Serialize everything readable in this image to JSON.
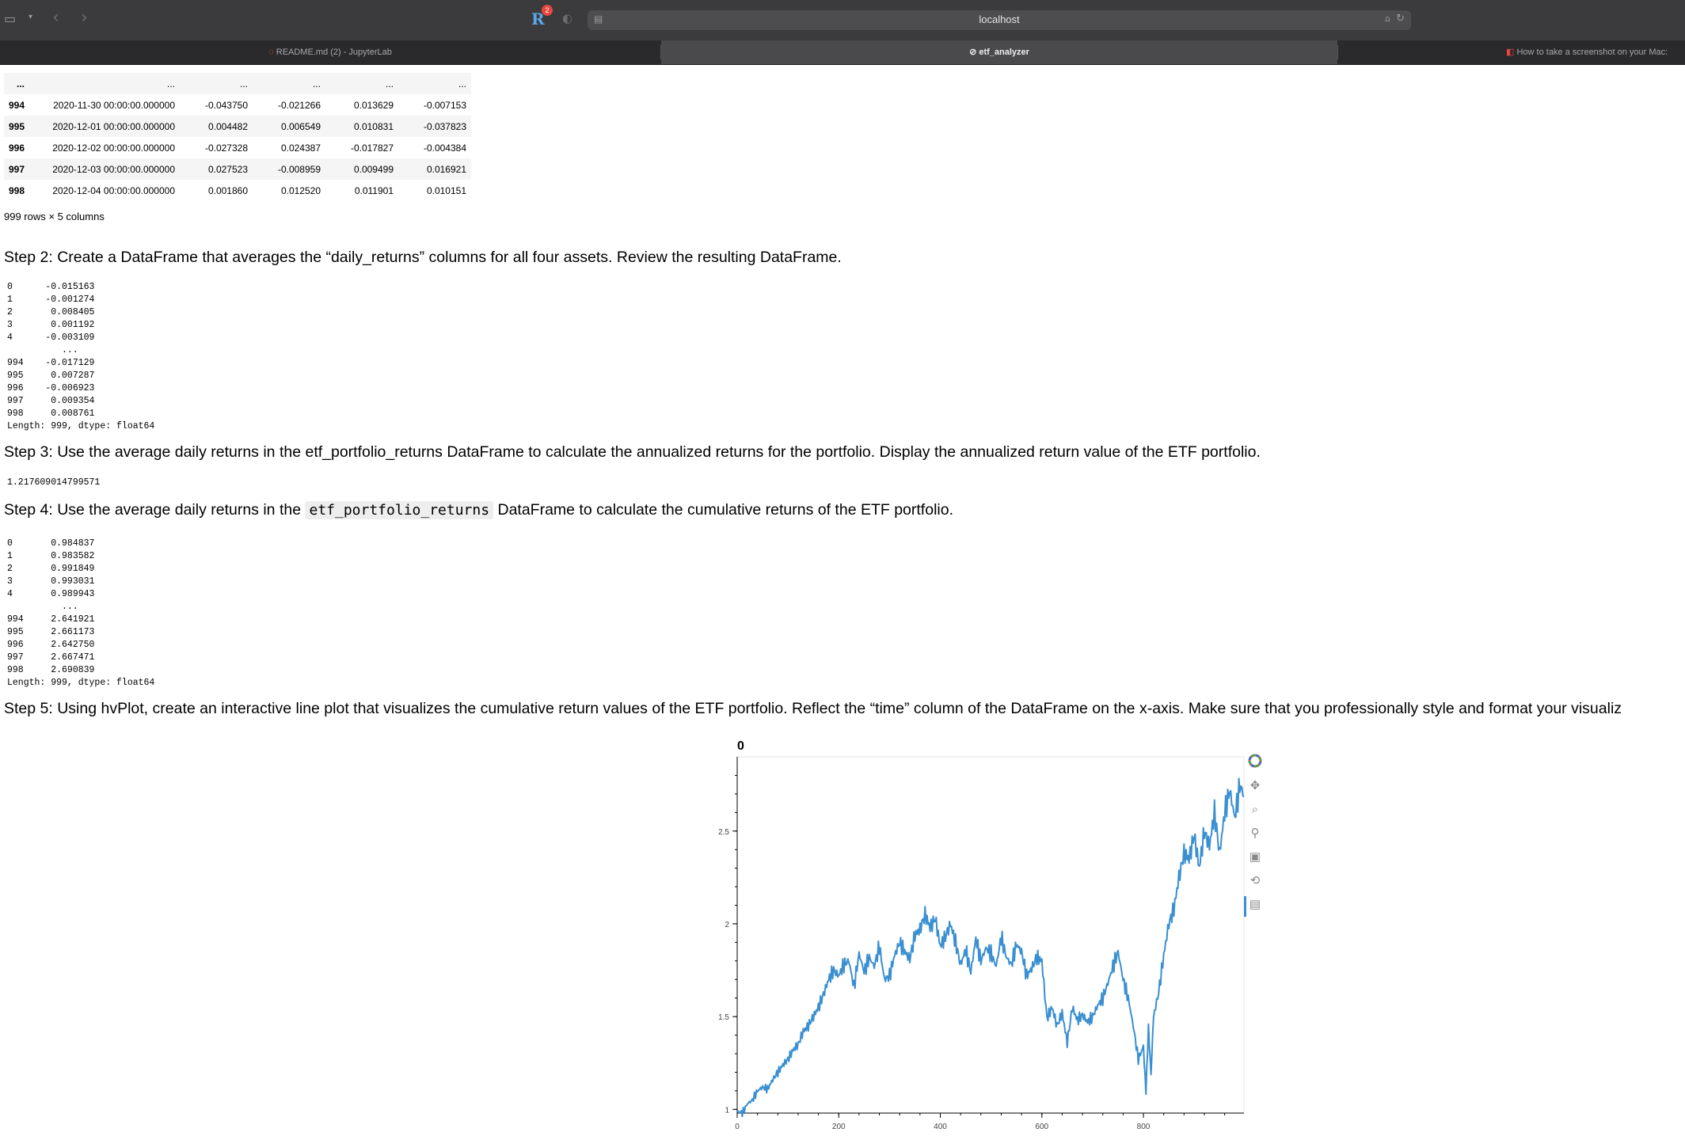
{
  "browser": {
    "address": "localhost",
    "extension_badge": "2",
    "extension_letter": "R",
    "tabs": [
      {
        "label": "README.md (2) - JupyterLab"
      },
      {
        "label": "etf_analyzer"
      },
      {
        "label": "How to take a screenshot on your Mac:"
      }
    ]
  },
  "dataframe": {
    "ellipsis_row": [
      "...",
      "...",
      "...",
      "...",
      "...",
      "..."
    ],
    "rows": [
      {
        "index": "994",
        "time": "2020-11-30 00:00:00.000000",
        "a": "-0.043750",
        "b": "-0.021266",
        "c": "0.013629",
        "d": "-0.007153"
      },
      {
        "index": "995",
        "time": "2020-12-01 00:00:00.000000",
        "a": "0.004482",
        "b": "0.006549",
        "c": "0.010831",
        "d": "-0.037823"
      },
      {
        "index": "996",
        "time": "2020-12-02 00:00:00.000000",
        "a": "-0.027328",
        "b": "0.024387",
        "c": "-0.017827",
        "d": "-0.004384"
      },
      {
        "index": "997",
        "time": "2020-12-03 00:00:00.000000",
        "a": "0.027523",
        "b": "-0.008959",
        "c": "0.009499",
        "d": "0.016921"
      },
      {
        "index": "998",
        "time": "2020-12-04 00:00:00.000000",
        "a": "0.001860",
        "b": "0.012520",
        "c": "0.011901",
        "d": "0.010151"
      }
    ],
    "footer": "999 rows × 5 columns"
  },
  "steps": {
    "step2": "Step 2: Create a DataFrame that averages the “daily_returns” columns for all four assets. Review the resulting DataFrame.",
    "step3": "Step 3: Use the average daily returns in the etf_portfolio_returns DataFrame to calculate the annualized returns for the portfolio. Display the annualized return value of the ETF portfolio.",
    "step4_before": "Step 4: Use the average daily returns in the",
    "step4_code": "etf_portfolio_returns",
    "step4_after": "DataFrame to calculate the cumulative returns of the ETF portfolio.",
    "step5": "Step 5: Using hvPlot, create an interactive line plot that visualizes the cumulative return values of the ETF portfolio. Reflect the “time” column of the DataFrame on the x-axis. Make sure that you professionally style and format your visualiz"
  },
  "outputs": {
    "averages": "0      -0.015163\n1      -0.001274\n2       0.008405\n3       0.001192\n4      -0.003109\n          ...   \n994    -0.017129\n995     0.007287\n996    -0.006923\n997     0.009354\n998     0.008761\nLength: 999, dtype: float64",
    "annualized": "1.217609014799571",
    "cumulative": "0       0.984837\n1       0.983582\n2       0.991849\n3       0.993031\n4       0.989943\n          ...   \n994     2.641921\n995     2.661173\n996     2.642750\n997     2.667471\n998     2.690839\nLength: 999, dtype: float64"
  },
  "chart_data": {
    "type": "line",
    "title": "0",
    "xlabel": "",
    "ylabel": "",
    "xlim": [
      0,
      998
    ],
    "ylim": [
      0.98,
      2.9
    ],
    "xticks": [
      0,
      200,
      400,
      600,
      800
    ],
    "yticks": [
      1,
      1.5,
      2,
      2.5
    ],
    "ytick_labels": [
      "1",
      "1.5",
      "2",
      "2.5"
    ],
    "color": "#3a8fd1",
    "x": [
      0,
      10,
      20,
      30,
      40,
      50,
      60,
      70,
      80,
      90,
      100,
      110,
      120,
      130,
      140,
      150,
      160,
      170,
      180,
      190,
      200,
      210,
      220,
      230,
      240,
      250,
      260,
      270,
      280,
      290,
      300,
      310,
      320,
      330,
      340,
      350,
      360,
      370,
      380,
      390,
      400,
      410,
      420,
      430,
      440,
      450,
      460,
      470,
      480,
      490,
      500,
      510,
      520,
      530,
      540,
      550,
      560,
      570,
      580,
      590,
      600,
      610,
      620,
      630,
      640,
      650,
      660,
      670,
      680,
      690,
      700,
      710,
      720,
      730,
      740,
      750,
      760,
      770,
      780,
      790,
      800,
      805,
      810,
      815,
      820,
      830,
      840,
      850,
      860,
      870,
      880,
      890,
      900,
      910,
      920,
      930,
      940,
      950,
      960,
      970,
      980,
      990,
      998
    ],
    "y": [
      0.99,
      0.98,
      1.03,
      1.05,
      1.1,
      1.12,
      1.11,
      1.16,
      1.2,
      1.24,
      1.27,
      1.32,
      1.35,
      1.42,
      1.45,
      1.5,
      1.55,
      1.62,
      1.7,
      1.75,
      1.72,
      1.78,
      1.8,
      1.66,
      1.84,
      1.74,
      1.82,
      1.77,
      1.88,
      1.7,
      1.72,
      1.83,
      1.9,
      1.85,
      1.81,
      1.94,
      1.97,
      2.05,
      1.98,
      2.03,
      1.88,
      1.93,
      2.0,
      1.9,
      1.78,
      1.86,
      1.74,
      1.92,
      1.8,
      1.87,
      1.84,
      1.77,
      1.93,
      1.82,
      1.78,
      1.89,
      1.85,
      1.72,
      1.76,
      1.82,
      1.8,
      1.49,
      1.55,
      1.45,
      1.52,
      1.36,
      1.55,
      1.48,
      1.51,
      1.47,
      1.5,
      1.56,
      1.6,
      1.68,
      1.77,
      1.85,
      1.7,
      1.6,
      1.45,
      1.27,
      1.34,
      1.1,
      1.43,
      1.2,
      1.5,
      1.63,
      1.83,
      2.0,
      2.08,
      2.25,
      2.38,
      2.35,
      2.48,
      2.3,
      2.5,
      2.42,
      2.6,
      2.38,
      2.6,
      2.72,
      2.57,
      2.75,
      2.69
    ]
  }
}
